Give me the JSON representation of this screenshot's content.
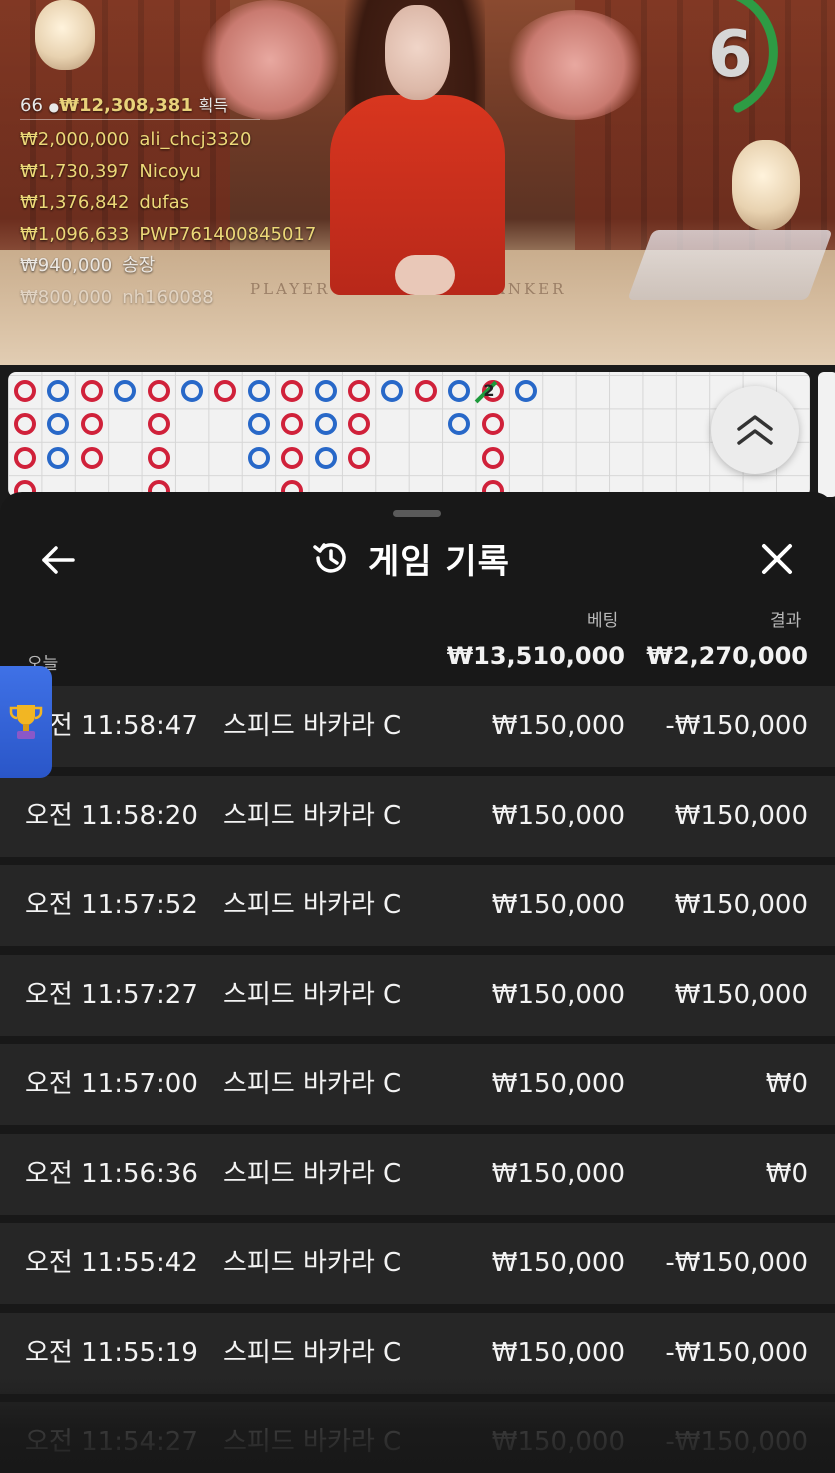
{
  "video": {
    "timer": "6",
    "winners_total": {
      "count": "66",
      "amount": "₩12,308,381",
      "label": "획득"
    },
    "winners": [
      {
        "amount": "₩2,000,000",
        "name": "ali_chcj3320"
      },
      {
        "amount": "₩1,730,397",
        "name": "Nicoyu"
      },
      {
        "amount": "₩1,376,842",
        "name": "dufas"
      },
      {
        "amount": "₩1,096,633",
        "name": "PWP761400845017"
      },
      {
        "amount": "₩940,000",
        "name": "송장"
      },
      {
        "amount": "₩800,000",
        "name": "nh160088"
      }
    ],
    "table_labels": {
      "player": "PLAYER",
      "banker": "BANKER"
    }
  },
  "road": {
    "tie_count": "2"
  },
  "sheet": {
    "title": "게임 기록",
    "columns": {
      "bet": "베팅",
      "result": "결과"
    },
    "today_label": "오늘",
    "totals": {
      "bet": "₩13,510,000",
      "result": "₩2,270,000"
    },
    "rows": [
      {
        "time": "오전 11:58:47",
        "game": "스피드 바카라 C",
        "bet": "₩150,000",
        "result": "-₩150,000"
      },
      {
        "time": "오전 11:58:20",
        "game": "스피드 바카라 C",
        "bet": "₩150,000",
        "result": "₩150,000"
      },
      {
        "time": "오전 11:57:52",
        "game": "스피드 바카라 C",
        "bet": "₩150,000",
        "result": "₩150,000"
      },
      {
        "time": "오전 11:57:27",
        "game": "스피드 바카라 C",
        "bet": "₩150,000",
        "result": "₩150,000"
      },
      {
        "time": "오전 11:57:00",
        "game": "스피드 바카라 C",
        "bet": "₩150,000",
        "result": "₩0"
      },
      {
        "time": "오전 11:56:36",
        "game": "스피드 바카라 C",
        "bet": "₩150,000",
        "result": "₩0"
      },
      {
        "time": "오전 11:55:42",
        "game": "스피드 바카라 C",
        "bet": "₩150,000",
        "result": "-₩150,000"
      },
      {
        "time": "오전 11:55:19",
        "game": "스피드 바카라 C",
        "bet": "₩150,000",
        "result": "-₩150,000"
      },
      {
        "time": "오전 11:54:27",
        "game": "스피드 바카라 C",
        "bet": "₩150,000",
        "result": "-₩150,000"
      }
    ]
  }
}
